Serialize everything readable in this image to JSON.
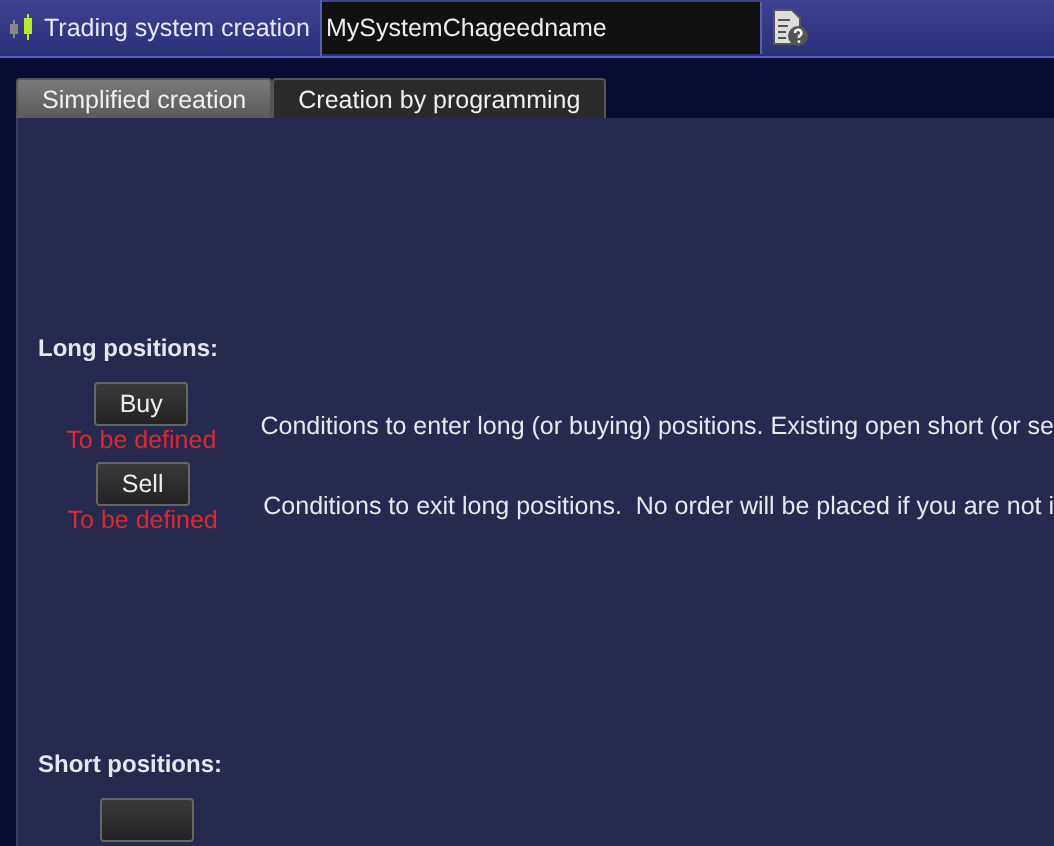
{
  "header": {
    "title": "Trading system creation",
    "name_value": "MySystemChageedname"
  },
  "tabs": [
    {
      "label": "Simplified creation",
      "selected": true
    },
    {
      "label": "Creation by programming",
      "selected": false
    }
  ],
  "sections": [
    {
      "title": "Long positions:",
      "rows": [
        {
          "button": "Buy",
          "status": "To be defined",
          "description": "Conditions to enter long (or buying) positions. Existing open short (or se"
        },
        {
          "button": "Sell",
          "status": "To be defined",
          "description": "Conditions to exit long positions.  No order will be placed if you are not i"
        }
      ]
    },
    {
      "title": "Short positions:",
      "rows": [
        {}
      ]
    }
  ]
}
